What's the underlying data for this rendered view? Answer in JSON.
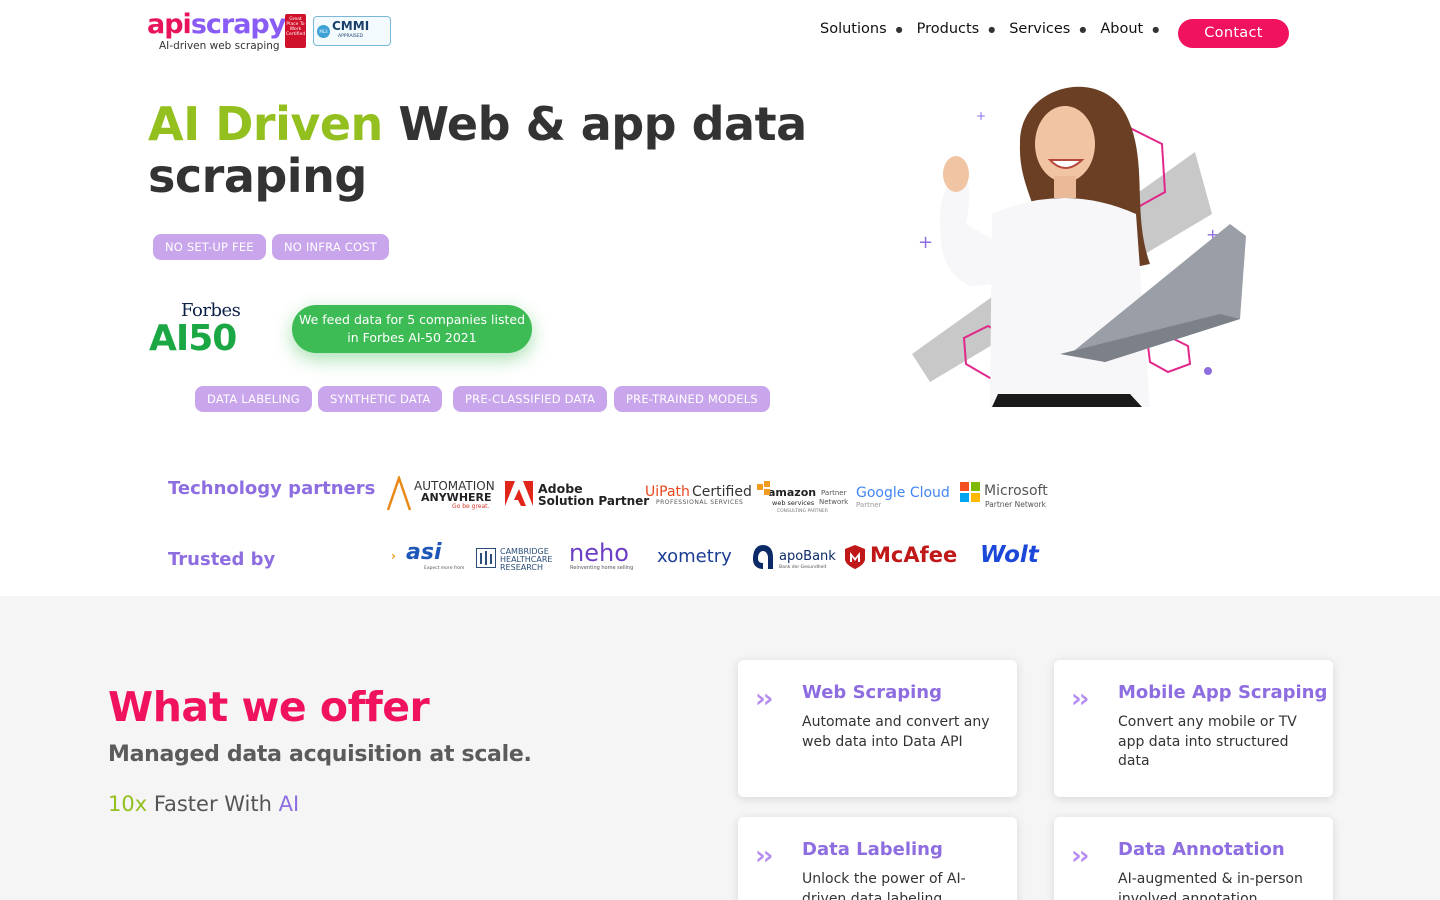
{
  "brand": {
    "logo_part1": "api",
    "logo_part2": "scrapy",
    "tagline": "AI-driven web scraping",
    "gptw_badge": "Great Place To Work Certified",
    "cmmi_title": "CMMI",
    "cmmi_sub": "APPRAISED",
    "cmmi_dot": "ML3"
  },
  "nav": {
    "items": [
      "Solutions",
      "Products",
      "Services",
      "About"
    ],
    "contact_label": "Contact"
  },
  "hero": {
    "title_accent": "AI Driven",
    "title_rest": " Web & app data scraping",
    "pills_top": [
      "NO SET-UP FEE",
      "NO INFRA COST"
    ],
    "forbes_top": "Forbes",
    "forbes_big": "AI50",
    "feed_text": "We feed data for 5 companies listed in Forbes AI-50 2021",
    "pills_bottom": [
      "DATA LABELING",
      "SYNTHETIC DATA",
      "PRE-CLASSIFIED DATA",
      "PRE-TRAINED MODELS"
    ]
  },
  "partners": {
    "tech_label": "Technology partners",
    "tech_logos": {
      "automation1": "AUTOMATION",
      "automation2": "ANYWHERE",
      "automation3": "Go be great.",
      "adobe1": "Adobe",
      "adobe2": "Solution Partner",
      "uipath1": "UiPath",
      "uipath2": "Certified",
      "uipath3": "PROFESSIONAL SERVICES",
      "aws1": "amazon",
      "aws2": "web services",
      "aws3": "Partner",
      "aws4": "Network",
      "aws5": "CONSULTING PARTNER",
      "google1": "Google Cloud",
      "google2": "Partner",
      "ms1": "Microsoft",
      "ms2": "Partner Network"
    },
    "trusted_label": "Trusted by",
    "trusted_logos": {
      "asi": "asi",
      "asi_sub": "Expect more from",
      "cambridge1": "CAMBRIDGE",
      "cambridge2": "HEALTHCARE",
      "cambridge3": "RESEARCH",
      "neho": "neho",
      "neho_sub": "Reinventing home selling",
      "xometry": "xometry",
      "apobank": "apoBank",
      "apobank_sub": "Bank der Gesundheit",
      "mcafee": "McAfee",
      "wolt": "Wolt"
    }
  },
  "offer": {
    "title": "What we offer",
    "subtitle": "Managed data acquisition at scale.",
    "fast_a": "10x",
    "fast_b": " Faster With ",
    "fast_c": "AI",
    "cards": [
      {
        "title": "Web Scraping",
        "desc": "Automate and convert any web data into Data API"
      },
      {
        "title": "Mobile App Scraping",
        "desc": "Convert any mobile or TV app data into structured data"
      },
      {
        "title": "Data Labeling",
        "desc": "Unlock the power of AI-driven data labeling"
      },
      {
        "title": "Data Annotation",
        "desc": "AI-augmented & in-person involved annotation"
      }
    ]
  },
  "colors": {
    "pink": "#f0125e",
    "purple": "#8d6de0",
    "green": "#93c01f",
    "pill": "#c9a6ec",
    "feed_green": "#3dbb55"
  }
}
